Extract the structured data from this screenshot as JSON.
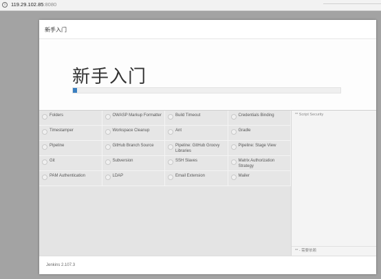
{
  "browser": {
    "host": "119.29.102.85",
    "port": ":8080"
  },
  "dialog": {
    "header_title": "新手入门",
    "hero_title": "新手入门",
    "progress": 0.015
  },
  "plugins": [
    {
      "name": "Folders"
    },
    {
      "name": "OWASP Markup Formatter"
    },
    {
      "name": "Build Timeout"
    },
    {
      "name": "Credentials Binding"
    },
    {
      "name": "Timestamper"
    },
    {
      "name": "Workspace Cleanup"
    },
    {
      "name": "Ant"
    },
    {
      "name": "Gradle"
    },
    {
      "name": "Pipeline"
    },
    {
      "name": "GitHub Branch Source"
    },
    {
      "name": "Pipeline: GitHub Groovy Libraries"
    },
    {
      "name": "Pipeline: Stage View"
    },
    {
      "name": "Git"
    },
    {
      "name": "Subversion"
    },
    {
      "name": "SSH Slaves"
    },
    {
      "name": "Matrix Authorization Strategy"
    },
    {
      "name": "PAM Authentication"
    },
    {
      "name": "LDAP"
    },
    {
      "name": "Email Extension"
    },
    {
      "name": "Mailer"
    }
  ],
  "side_panel": {
    "top_text": "** Script Security",
    "bottom_text": "** - 需要依赖"
  },
  "footer": {
    "version": "Jenkins 2.107.3"
  },
  "colors": {
    "progress_accent": "#3a7fc0"
  }
}
